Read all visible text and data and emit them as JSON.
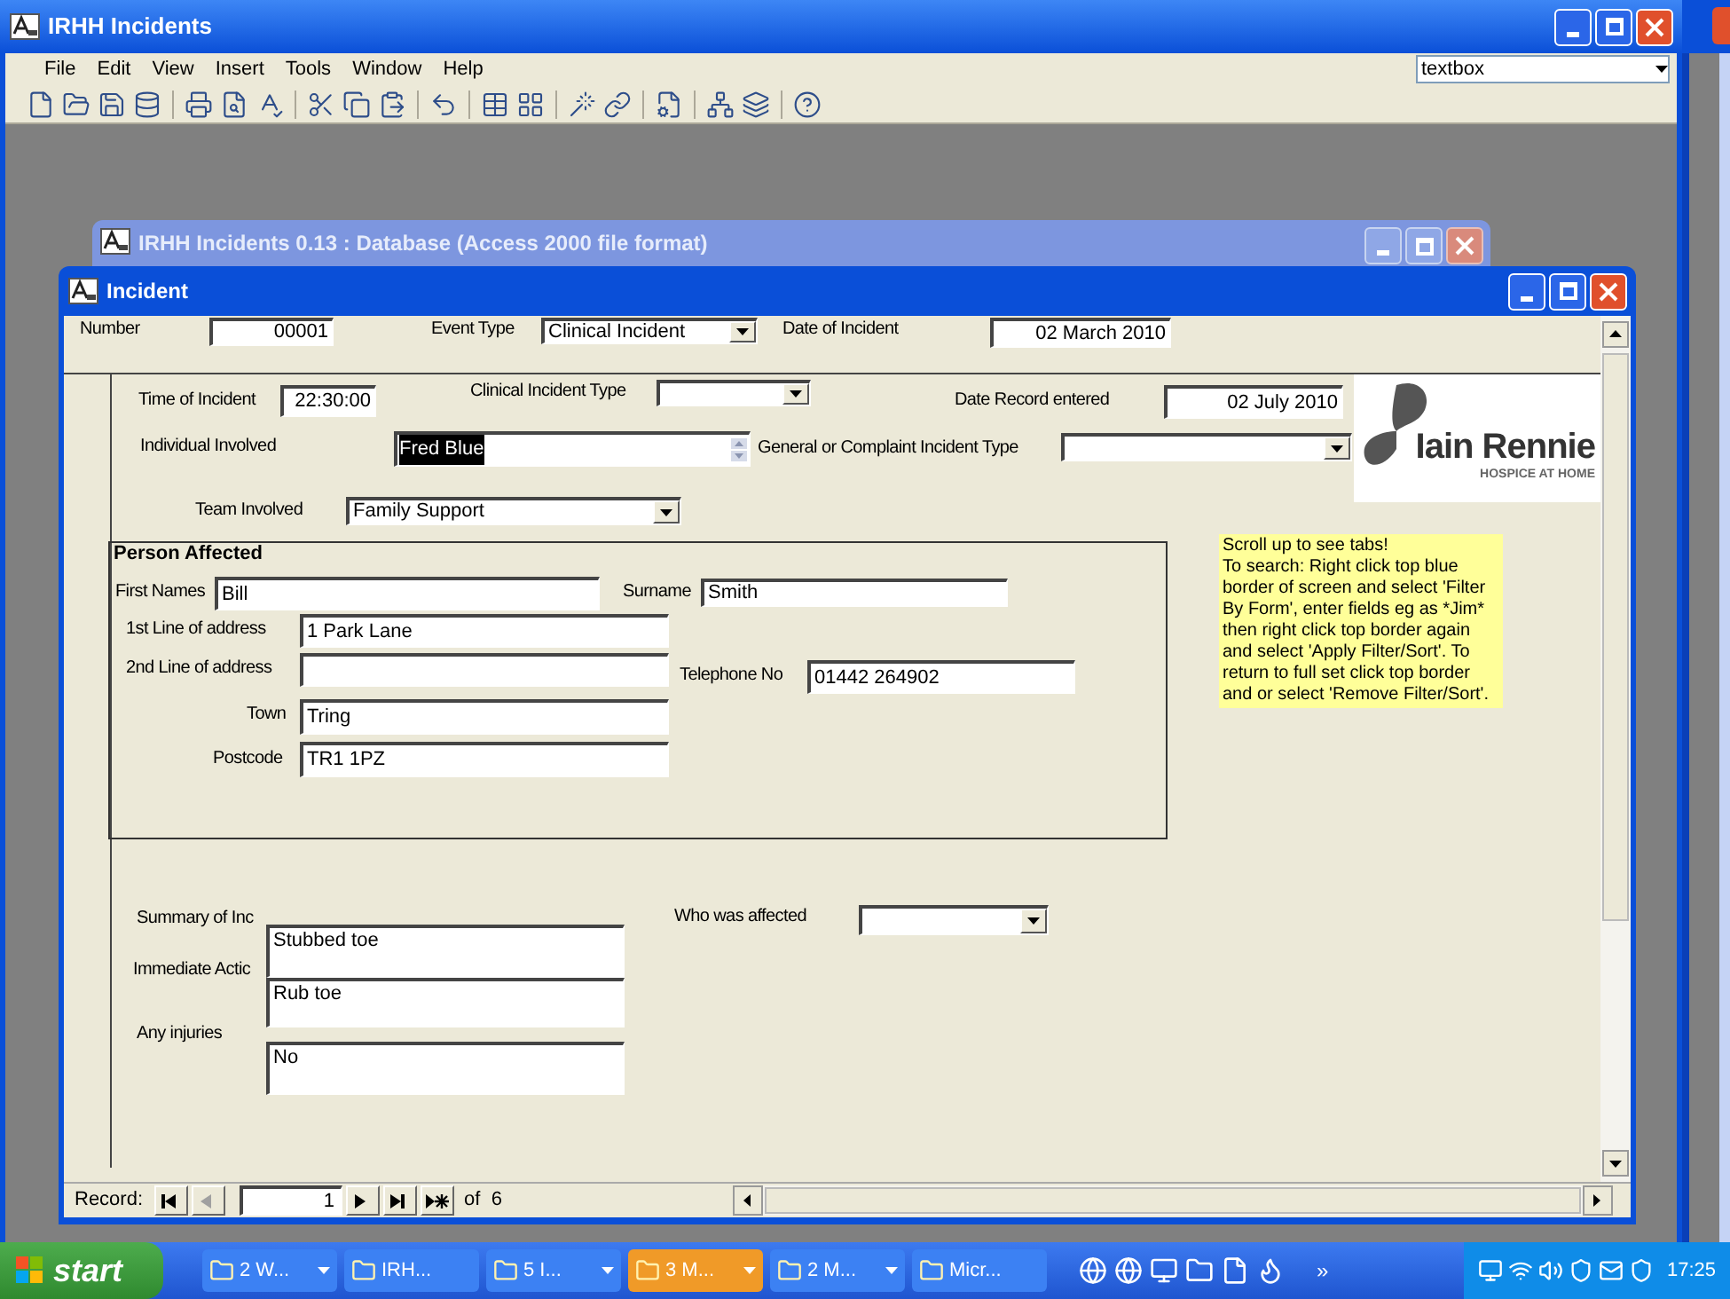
{
  "app_window": {
    "title": "IRHH Incidents",
    "menu": [
      "File",
      "Edit",
      "View",
      "Insert",
      "Tools",
      "Window",
      "Help"
    ],
    "type_box": "textbox"
  },
  "database_window": {
    "title": "IRHH Incidents 0.13 : Database (Access 2000 file format)"
  },
  "form_window": {
    "title": "Incident",
    "controls": [
      {
        "kind": "label",
        "text": "Number"
      },
      {
        "kind": "text",
        "value": "00001"
      },
      {
        "kind": "label",
        "text": "Event Type"
      },
      {
        "kind": "combo",
        "value": "Clinical Incident"
      },
      {
        "kind": "label",
        "text": "Date of Incident"
      },
      {
        "kind": "text",
        "value": "02 March 2010"
      },
      {
        "kind": "label",
        "text": "Time of Incident"
      },
      {
        "kind": "text",
        "value": "22:30:00"
      },
      {
        "kind": "label",
        "text": "Clinical Incident Type"
      },
      {
        "kind": "combo"
      },
      {
        "kind": "label",
        "text": "Date Record entered"
      },
      {
        "kind": "text",
        "value": "02 July 2010"
      },
      {
        "kind": "label",
        "text": "Individual Involved"
      },
      {
        "kind": "spin",
        "value": "Fred Blue",
        "text_selected": true
      },
      {
        "kind": "label",
        "text": "General or Complaint Incident Type"
      },
      {
        "kind": "combo"
      },
      {
        "kind": "label",
        "text": "Team Involved"
      },
      {
        "kind": "combo",
        "value": "Family Support"
      },
      {
        "kind": "section_title",
        "text": "Person Affected"
      },
      {
        "kind": "label",
        "text": "First Names"
      },
      {
        "kind": "text",
        "value": "Bill"
      },
      {
        "kind": "label",
        "text": "Surname"
      },
      {
        "kind": "text",
        "value": "Smith"
      },
      {
        "kind": "label",
        "text": "1st Line of address"
      },
      {
        "kind": "text",
        "value": "1 Park Lane"
      },
      {
        "kind": "label",
        "text": "2nd Line of address"
      },
      {
        "kind": "text"
      },
      {
        "kind": "label",
        "text": "Telephone No"
      },
      {
        "kind": "text",
        "value": "01442 264902"
      },
      {
        "kind": "label",
        "text": "Town"
      },
      {
        "kind": "text",
        "value": "Tring"
      },
      {
        "kind": "label",
        "text": "Postcode"
      },
      {
        "kind": "text",
        "value": "TR1 1PZ"
      },
      {
        "kind": "label",
        "text": "Summary of Inc"
      },
      {
        "kind": "label",
        "text": "Immediate Actic"
      },
      {
        "kind": "label",
        "text": "Any injuries"
      },
      {
        "kind": "memo",
        "value": "Stubbed toe"
      },
      {
        "kind": "memo",
        "value": "Rub toe"
      },
      {
        "kind": "memo",
        "value": "No"
      },
      {
        "kind": "label",
        "text": "Who was affected"
      },
      {
        "kind": "combo"
      }
    ],
    "logo": {
      "name": "Iain Rennie",
      "tagline": "HOSPICE AT HOME"
    },
    "note": [
      "Scroll up to see tabs!",
      "To search: Right click top blue border of screen and select 'Filter By Form', enter fields eg as *Jim* then right click top border again and select 'Apply Filter/Sort'. To return to full set click top border and or select 'Remove Filter/Sort'."
    ],
    "record_nav": {
      "label": "Record:",
      "current": "1",
      "count": "of  6",
      "buttons": [
        {
          "kind": "first",
          "disabled": false
        },
        {
          "kind": "prev",
          "disabled": true
        }
      ],
      "buttons_after": [
        {
          "kind": "next",
          "disabled": false
        },
        {
          "kind": "last",
          "disabled": false
        },
        {
          "kind": "new",
          "disabled": false
        }
      ]
    }
  },
  "taskbar": {
    "start": "start",
    "items": [
      {
        "label": "2 W...",
        "highlighted": false,
        "grouped": true
      },
      {
        "label": "IRH...",
        "highlighted": false,
        "grouped": false
      },
      {
        "label": "5 I...",
        "highlighted": false,
        "grouped": true
      },
      {
        "label": "3 M...",
        "highlighted": true,
        "grouped": true
      },
      {
        "label": "2 M...",
        "highlighted": false,
        "grouped": true
      },
      {
        "label": "Micr...",
        "highlighted": false,
        "grouped": false
      }
    ],
    "more": "»",
    "clock": "17:25"
  }
}
